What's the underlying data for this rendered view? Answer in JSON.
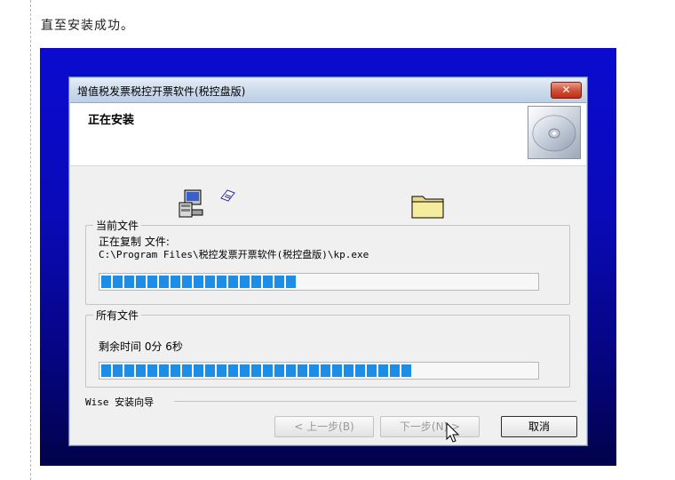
{
  "page": {
    "caption": "直至安装成功。"
  },
  "dialog": {
    "title": "增值税发票税控开票软件(税控盘版)",
    "close_label": "✕",
    "header_title": "正在安装",
    "current_file": {
      "legend": "当前文件",
      "action": "正在复制 文件:",
      "path": "C:\\Program Files\\税控发票开票软件(税控盘版)\\kp.exe",
      "progress": 0.46
    },
    "all_files": {
      "legend": "所有文件",
      "remaining": "剩余时间 0分 6秒",
      "progress": 0.72
    },
    "wise_label": "Wise 安装向导",
    "buttons": {
      "back": "< 上一步(B)",
      "next": "下一步(N) >",
      "cancel": "取消"
    },
    "icons": [
      "setup-computer-icon",
      "document-fly-icon",
      "folder-icon",
      "cd-disc-icon",
      "mouse-cursor-icon"
    ]
  }
}
